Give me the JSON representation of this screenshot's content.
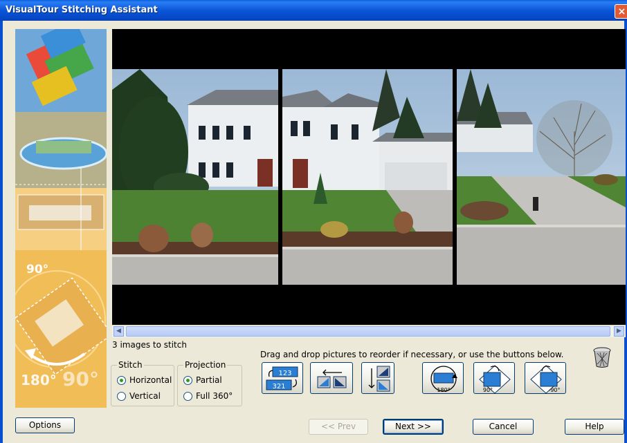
{
  "window": {
    "title": "VisualTour Stitching Assistant",
    "close_glyph": "×"
  },
  "status": {
    "image_count": "3 images to stitch"
  },
  "instructions": "Drag and drop pictures to reorder if necessary, or use the buttons below.",
  "stitch": {
    "legend": "Stitch",
    "options": [
      {
        "label": "Horizontal",
        "selected": true
      },
      {
        "label": "Vertical",
        "selected": false
      }
    ]
  },
  "projection": {
    "legend": "Projection",
    "options": [
      {
        "label": "Partial",
        "selected": true
      },
      {
        "label": "Full 360°",
        "selected": false
      }
    ]
  },
  "tools": {
    "reverse": {
      "top": "123",
      "bottom": "321",
      "icon": "reverse-order-icon"
    },
    "move_left": {
      "icon": "move-left-icon"
    },
    "swap": {
      "icon": "swap-icon"
    },
    "rotate180": {
      "label": "180°",
      "icon": "rotate-180-icon"
    },
    "rotate90": {
      "label": "90°",
      "icon": "rotate-90-icon"
    },
    "rotate_minus90": {
      "label": "-90°",
      "icon": "rotate-minus-90-icon"
    },
    "trash": {
      "icon": "trash-icon"
    }
  },
  "sidebar": {
    "label_90": "90°",
    "label_180": "180°",
    "label_90b": "90°"
  },
  "buttons": {
    "options": "Options",
    "prev": "<< Prev",
    "next": "Next >>",
    "cancel": "Cancel",
    "help": "Help"
  },
  "colors": {
    "title_bar": "#0a56d8",
    "accent": "#003c74",
    "sidebar": "#f0b84c"
  }
}
